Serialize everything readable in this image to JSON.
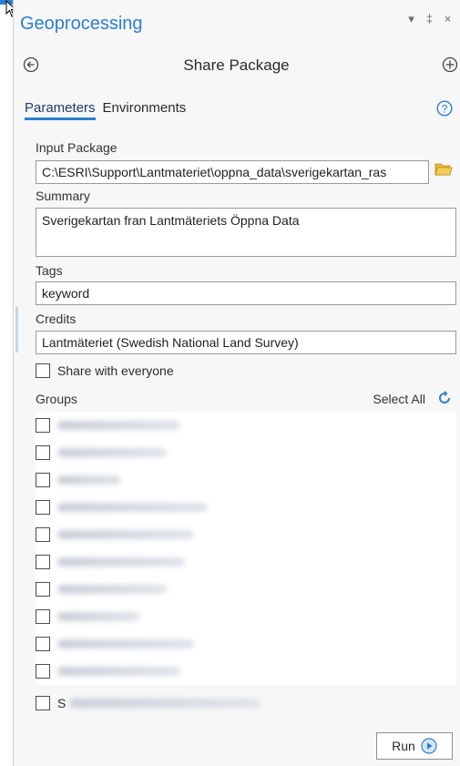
{
  "pane": {
    "title": "Geoprocessing",
    "controls": {
      "pin": "▾",
      "auto_hide": "‡",
      "close": "×"
    }
  },
  "tool": {
    "title": "Share Package",
    "back_icon": "back-arrow-icon",
    "add_icon": "add-icon"
  },
  "tabs": [
    {
      "label": "Parameters",
      "active": true
    },
    {
      "label": "Environments",
      "active": false
    }
  ],
  "help_icon": "help-icon",
  "params": {
    "input_package": {
      "label": "Input Package",
      "value": "C:\\ESRI\\Support\\Lantmateriet\\oppna_data\\sverigekartan_ras"
    },
    "summary": {
      "label": "Summary",
      "value": "Sverigekartan fran Lantmäteriets Öppna Data"
    },
    "tags": {
      "label": "Tags",
      "value": "keyword"
    },
    "credits": {
      "label": "Credits",
      "value": "Lantmäteriet (Swedish National Land Survey)"
    },
    "share_everyone": {
      "label": "Share with everyone",
      "checked": false
    },
    "groups": {
      "label": "Groups",
      "select_all": "Select All",
      "items": [
        {
          "checked": false
        },
        {
          "checked": false
        },
        {
          "checked": false
        },
        {
          "checked": false
        },
        {
          "checked": false
        },
        {
          "checked": false
        },
        {
          "checked": false
        },
        {
          "checked": false
        },
        {
          "checked": false
        },
        {
          "checked": false
        }
      ]
    },
    "share_org": {
      "label_prefix": "S",
      "checked": false
    }
  },
  "run": {
    "label": "Run"
  },
  "colors": {
    "accent": "#2a7fd4",
    "title": "#2a7fd4"
  }
}
